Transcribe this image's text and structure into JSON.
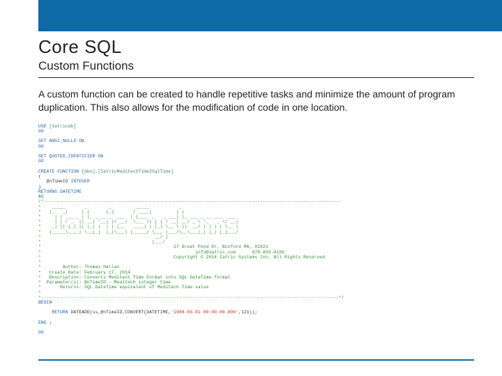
{
  "header": {
    "title": "Core SQL",
    "subtitle": "Custom Functions"
  },
  "body": {
    "paragraph": "A custom function can be created to handle repetitive tasks and minimize the amount of program duplication.  This also allows for the modification of code in one location."
  },
  "code": {
    "line01_kw": "USE",
    "line01_obj": " [Iatricdb]",
    "line02_kw": "GO",
    "line03": "",
    "line04_kw": "SET ANSI_NULLS ON",
    "line05_kw": "GO",
    "line06": "",
    "line07_kw": "SET QUOTED_IDENTIFIER ON",
    "line08_kw": "GO",
    "line09": "",
    "line10_kw": "CREATE FUNCTION ",
    "line10_obj": "[dbo].[IatricMeditechTime2SqlTime]",
    "line11_a": "(",
    "line12_a": "   @nTimeID ",
    "line12_kw": "INTEGER",
    "line13_a": ")",
    "line14_kw": "RETURNS DATETIME",
    "line15_kw": "AS",
    "line16_cmt": "/*--------------------------------------------------------------------------------------------------------------",
    "line17_cmt": "*    _____       _        _         _____           _                     ",
    "line18_cmt": "*   |_   _|     | |      (_)       / ____|         | |                    ",
    "line19_cmt": "*     | |  __ _ | |_ _ __ _  ___  | (___  _   _ ___| |_ ___ _ __ ___  ___ ",
    "line20_cmt": "*     | | / _` || __| '__| |/ __|  \\___ \\| | | / __| __/ _ \\ '_ ` _ \\/ __|",
    "line21_cmt": "*    _| || (_| || |_| |  | | (__   ____) | |_| \\__ \\ ||  __/ | | | | \\__ \\",
    "line22_cmt": "*   |_____\\__,_| \\__|_|  |_|\\___| |_____/ \\__, |___/\\__\\___|_| |_| |_|___/",
    "line23_cmt": "*                                          __/ |                          ",
    "line24_cmt": "*                                         |___/                           ",
    "line25_cmt": "*                                                 27 Great Pond Dr, Boxford MA, 01921",
    "line26_cmt": "*                                                         info@iatric.com      978-805-4100",
    "line27_cmt": "*                                                 Copyright © 2014 Iatric Systems Inc. All Rights Reserved",
    "line28_cmt": "*",
    "line29_cmt": "*        Author: Thomas Harlan",
    "line30_cmt": "*   Create Date: February 17, 2014",
    "line31_cmt": "*   Description: Converts Meditech Time Format into SQL DateTime format",
    "line32_cmt": "*  Parameter(s): @nTimeID - Meditech integer time",
    "line33_cmt": "*       Returns: SQL DateTime equivalent of Meditech Time value",
    "line34_cmt": "*",
    "line35_cmt": "*--------------------------------------------------------------------------------------------------------------*/",
    "line36_kw": "BEGIN",
    "line37": "",
    "line38_a": "     ",
    "line38_kw": "RETURN ",
    "line38_b": "DATEADD(ss,@nTimeID,",
    "line38_c": "CONVERT(DATETIME,",
    "line38_str": "'1980-03-01 00:00:00.000'",
    "line38_d": ",121));",
    "line39": "",
    "line40_kw": "END ",
    "line40_a": ";",
    "line41": "",
    "line42_kw": "GO"
  }
}
